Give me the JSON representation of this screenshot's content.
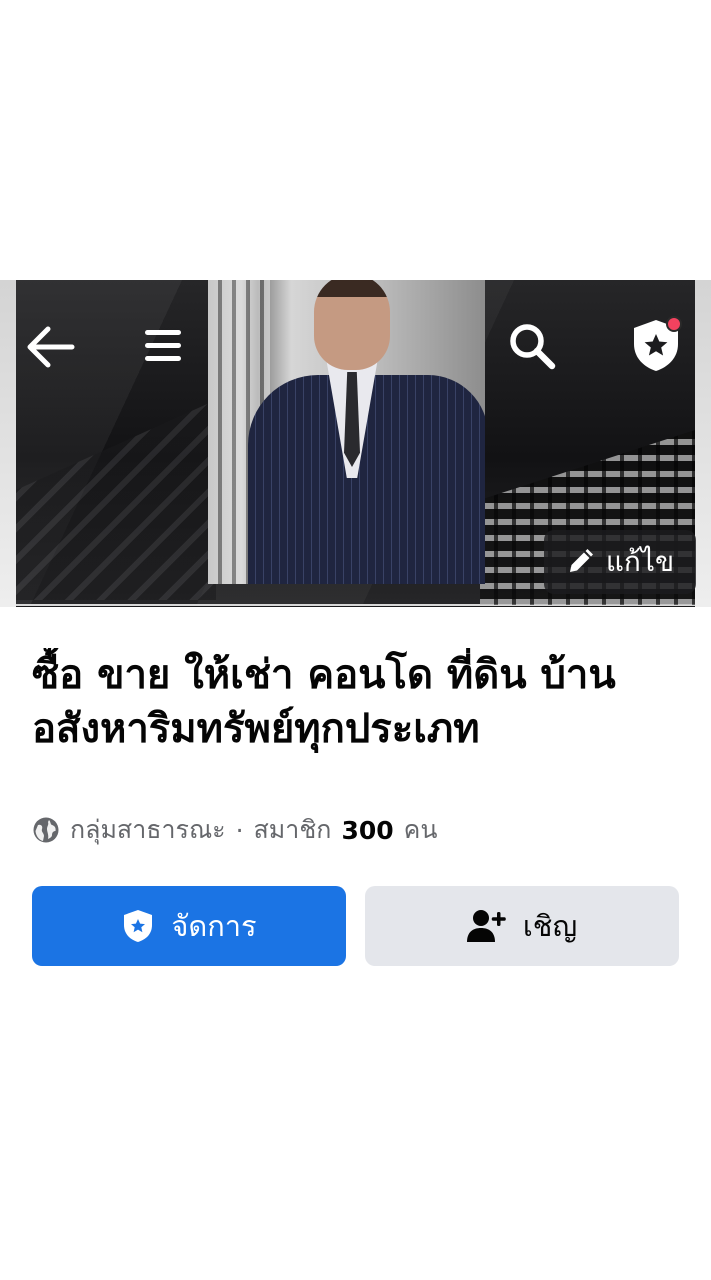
{
  "cover": {
    "edit_label": "แก้ไข"
  },
  "group": {
    "title": "ซื้อ ขาย ให้เช่า คอนโด ที่ดิน บ้าน อสังหาริมทรัพย์ทุกประเภท",
    "privacy_label": "กลุ่มสาธารณะ",
    "separator": "·",
    "members_prefix": "สมาชิก",
    "members_count": "300",
    "members_unit": "คน"
  },
  "actions": {
    "manage_label": "จัดการ",
    "invite_label": "เชิญ"
  },
  "icons": {
    "back": "arrow-left-icon",
    "menu": "hamburger-menu-icon",
    "search": "search-icon",
    "admin": "admin-shield-star-icon",
    "edit": "pencil-icon",
    "privacy": "globe-icon",
    "invite": "person-add-icon"
  },
  "colors": {
    "primary": "#1b74e4",
    "secondary_button": "#e4e6eb",
    "notification": "#f3425f",
    "muted_text": "#65676b"
  }
}
